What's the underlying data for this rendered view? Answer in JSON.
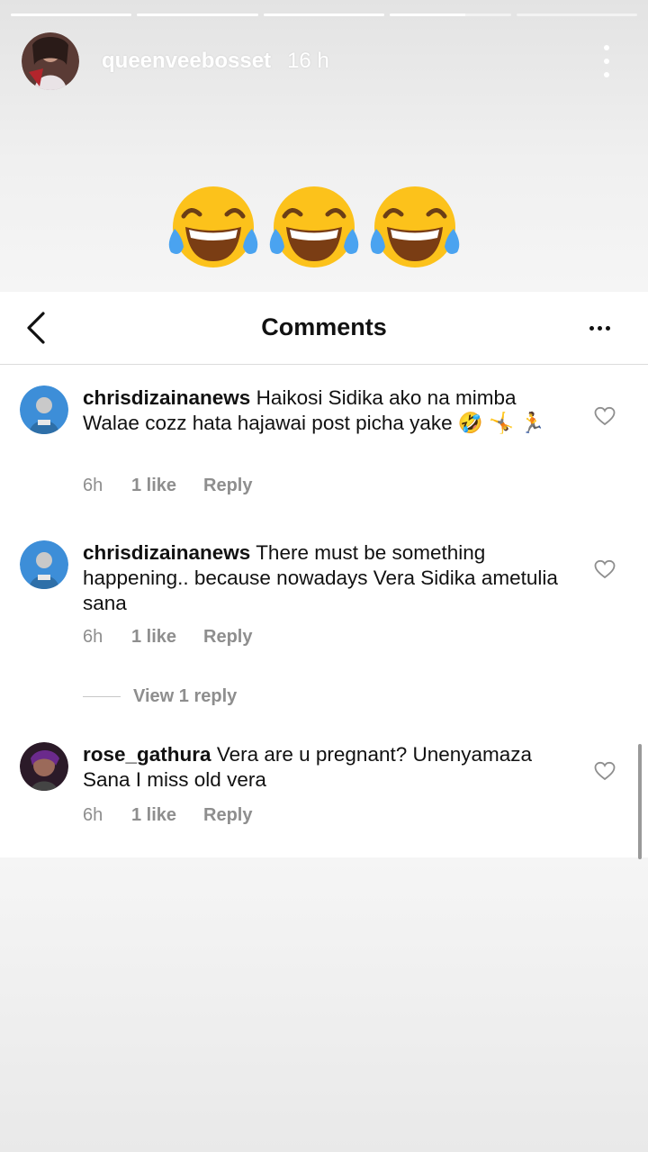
{
  "story": {
    "progress": [
      1,
      1,
      1,
      0.62,
      0
    ],
    "username": "queenveebosset",
    "time": "16 h",
    "emojis": [
      "face-with-tears-of-joy",
      "face-with-tears-of-joy",
      "face-with-tears-of-joy"
    ]
  },
  "comments_panel": {
    "title": "Comments",
    "view_replies_label": "View 1 reply",
    "comments": [
      {
        "username": "chrisdizainanews",
        "text": "Haikosi Sidika ako na mimba Walae cozz hata hajawai post picha yake",
        "emojis": "🤣 🤸 🏃",
        "time": "6h",
        "likes": "1 like",
        "reply": "Reply"
      },
      {
        "username": "chrisdizainanews",
        "text": "There must be something happening.. because nowadays Vera Sidika ametulia sana",
        "time": "6h",
        "likes": "1 like",
        "reply": "Reply"
      },
      {
        "username": "rose_gathura",
        "text": "Vera are u pregnant? Unenyamaza Sana I miss old vera",
        "time": "6h",
        "likes": "1 like",
        "reply": "Reply"
      }
    ]
  },
  "colors": {
    "text": "#111111",
    "meta": "#8e8e8e",
    "divider": "#dbdbdb",
    "emoji_yellow": "#fcc21b"
  }
}
